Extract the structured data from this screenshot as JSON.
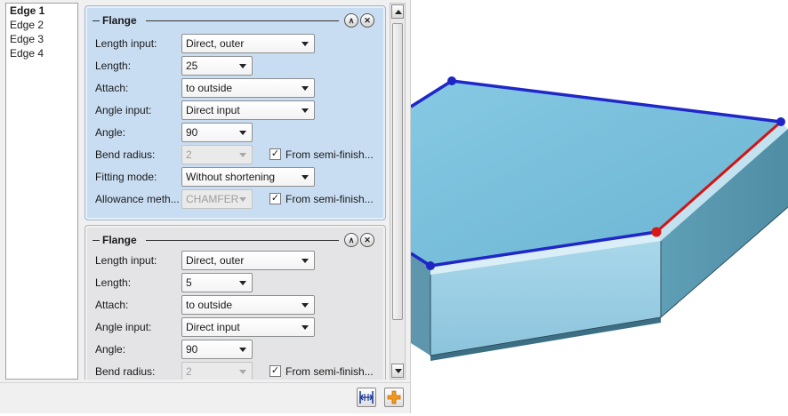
{
  "edges": [
    "Edge 1",
    "Edge 2",
    "Edge 3",
    "Edge 4"
  ],
  "selected_edge": "Edge 1",
  "flanges": [
    {
      "title": "Flange",
      "length_input_label": "Length input:",
      "length_input_value": "Direct, outer",
      "length_label": "Length:",
      "length_value": "25",
      "attach_label": "Attach:",
      "attach_value": "to outside",
      "angle_input_label": "Angle input:",
      "angle_input_value": "Direct input",
      "angle_label": "Angle:",
      "angle_value": "90",
      "bend_radius_label": "Bend radius:",
      "bend_radius_value": "2",
      "bend_radius_checkbox": "From semi-finish...",
      "fitting_mode_label": "Fitting mode:",
      "fitting_mode_value": "Without shortening",
      "allowance_label": "Allowance meth...",
      "allowance_value": "CHAMFER",
      "allowance_checkbox": "From semi-finish..."
    },
    {
      "title": "Flange",
      "length_input_label": "Length input:",
      "length_input_value": "Direct, outer",
      "length_label": "Length:",
      "length_value": "5",
      "attach_label": "Attach:",
      "attach_value": "to outside",
      "angle_input_label": "Angle input:",
      "angle_input_value": "Direct input",
      "angle_label": "Angle:",
      "angle_value": "90",
      "bend_radius_label": "Bend radius:",
      "bend_radius_value": "2",
      "bend_radius_checkbox": "From semi-finish..."
    }
  ],
  "icons": {
    "collapse": "chevron-up-icon",
    "close": "close-icon",
    "measure": "measure-icon",
    "add": "add-icon",
    "checkmark": "✓"
  },
  "colors": {
    "active_panel": "#c9ddf2",
    "inactive_panel": "#e4e4e6",
    "top_face": "#74bcd8",
    "edge_blue": "#1f27c9",
    "edge_red": "#d11414",
    "add_icon": "#f29a1f"
  }
}
